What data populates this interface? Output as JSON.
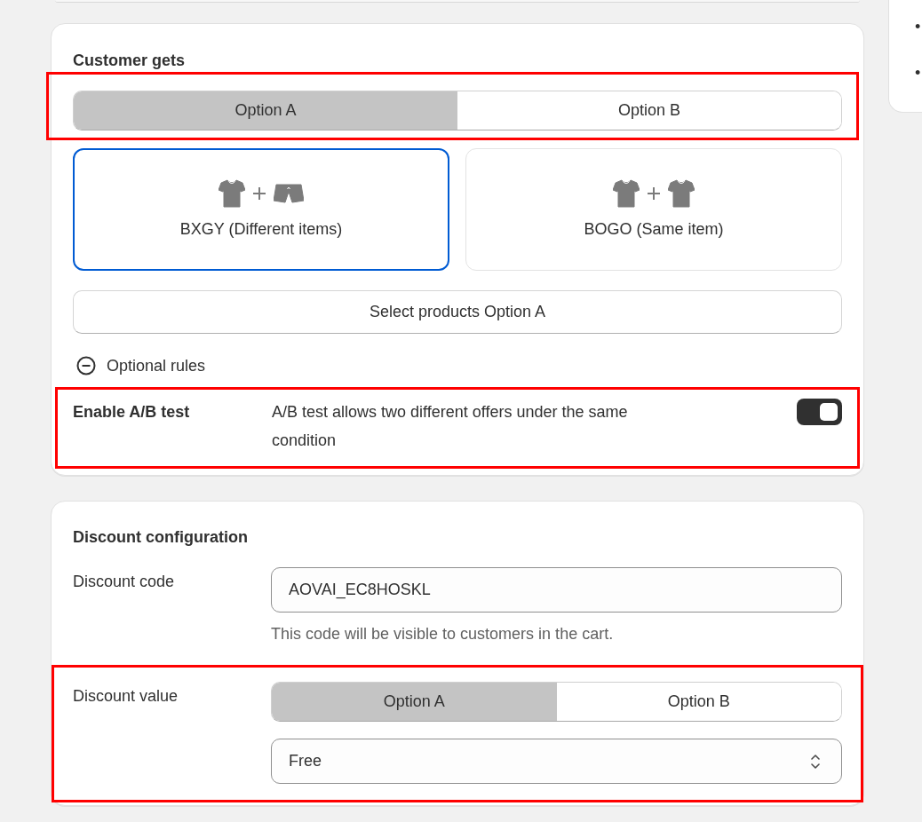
{
  "side_panel": {
    "bullets": [
      "•",
      "•"
    ]
  },
  "customer_gets": {
    "title": "Customer gets",
    "option_tabs": {
      "highlighted": true,
      "items": [
        {
          "label": "Option A",
          "selected": true
        },
        {
          "label": "Option B",
          "selected": false
        }
      ]
    },
    "offer_types": [
      {
        "kind": "different",
        "label": "BXGY (Different items)",
        "selected": true
      },
      {
        "kind": "same",
        "label": "BOGO (Same item)",
        "selected": false
      }
    ],
    "select_button": "Select products Option A",
    "optional_rules": {
      "label": "Optional rules",
      "expanded": true
    },
    "ab_test": {
      "highlighted": true,
      "label": "Enable A/B test",
      "description": "A/B test allows two different offers under the same condition",
      "on": true
    }
  },
  "discount_configuration": {
    "title": "Discount configuration",
    "discount_code": {
      "label": "Discount code",
      "value": "AOVAI_EC8HOSKL",
      "help": "This code will be visible to customers in the cart."
    },
    "discount_value": {
      "highlighted": true,
      "label": "Discount value",
      "option_tabs": [
        {
          "label": "Option A",
          "selected": true
        },
        {
          "label": "Option B",
          "selected": false
        }
      ],
      "select": {
        "value": "Free"
      }
    }
  }
}
